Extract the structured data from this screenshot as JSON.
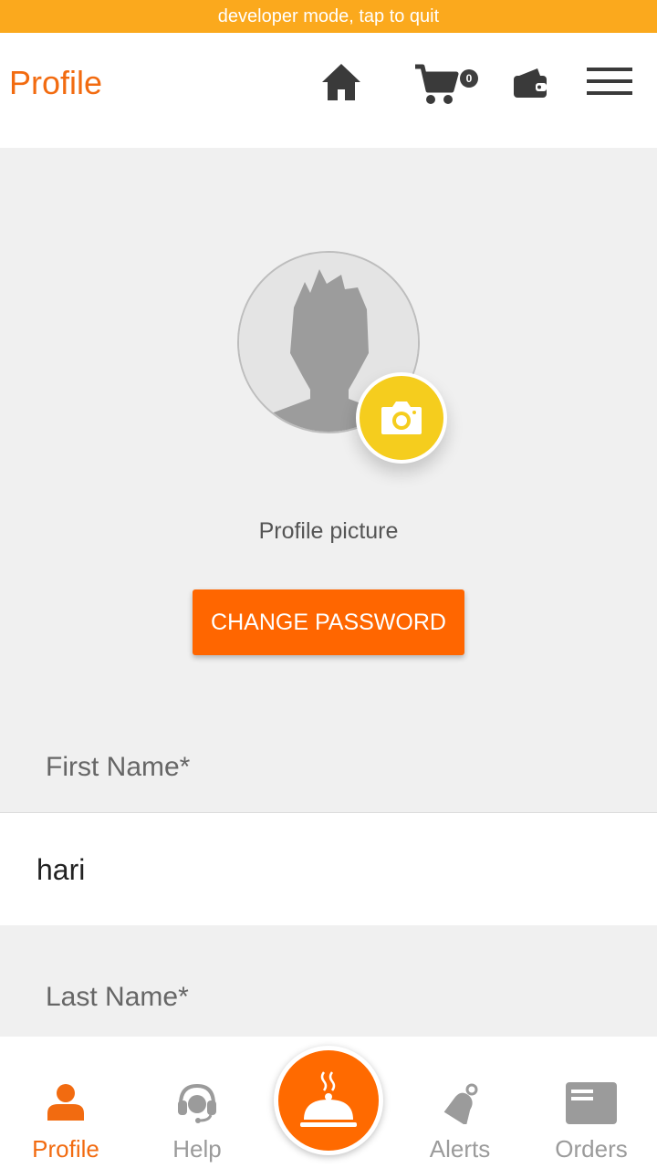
{
  "dev_banner": {
    "text": "developer mode, tap to quit"
  },
  "header": {
    "title": "Profile",
    "cart_count": "0",
    "icons": [
      "home-icon",
      "cart-icon",
      "wallet-icon",
      "menu-icon"
    ]
  },
  "profile": {
    "picture_label": "Profile picture",
    "change_password_label": "CHANGE PASSWORD"
  },
  "form": {
    "first_name_label": "First Name*",
    "first_name_value": "hari",
    "last_name_label": "Last Name*"
  },
  "bottom_nav": {
    "items": [
      {
        "label": "Profile",
        "icon": "person-icon",
        "active": true
      },
      {
        "label": "Help",
        "icon": "headset-icon",
        "active": false
      },
      {
        "label": "Alerts",
        "icon": "bell-icon",
        "active": false
      },
      {
        "label": "Orders",
        "icon": "orders-icon",
        "active": false
      }
    ],
    "center_icon": "food-cloche-icon"
  },
  "colors": {
    "accent": "#ff6600",
    "banner": "#fba91d",
    "camera": "#f5cd1e",
    "inactive": "#9b9b9b"
  }
}
